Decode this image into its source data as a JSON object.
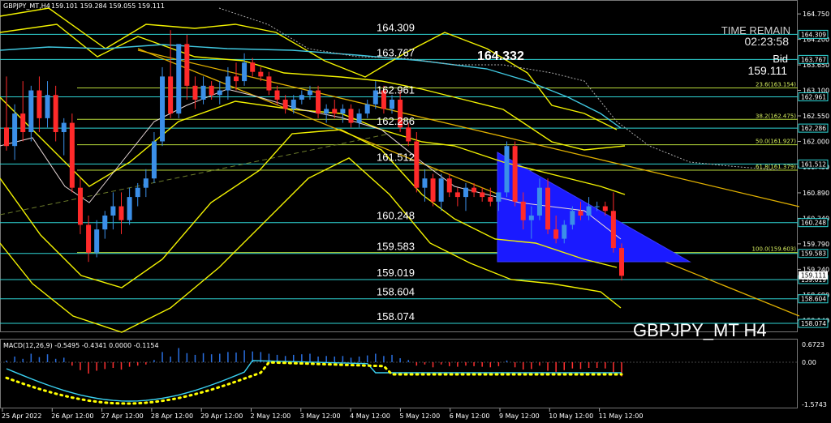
{
  "header": {
    "symbol_line": "GBPJPY_MT,H4",
    "ohlc": "159.101 159.284 159.055 159.111"
  },
  "time_remain": {
    "label": "TIME REMAIN",
    "value": "02:23:58"
  },
  "bid": {
    "label": "Bid",
    "value": "159.111"
  },
  "high_marker": "164.332",
  "watermark": "GBPJPY_MT H4",
  "macd": {
    "label": "MACD(12,26,9) -0.5495 -0.4341 0.0000 -0.1154",
    "axis_ticks": [
      "0.6723",
      "0.00",
      "-1.5743"
    ]
  },
  "price_axis": {
    "ticks": [
      "164.750",
      "164.200",
      "163.650",
      "163.100",
      "162.550",
      "162.000",
      "161.450",
      "160.890",
      "160.340",
      "159.790",
      "159.240",
      "158.690",
      "158.140"
    ],
    "tag_labels": [
      "164.309",
      "163.767",
      "162.961",
      "162.286",
      "161.512",
      "160.248",
      "159.583",
      "159.019",
      "158.604",
      "158.074"
    ],
    "current_price_tag": "159.111"
  },
  "time_axis": {
    "labels": [
      "25 Apr 2022",
      "26 Apr 12:00",
      "27 Apr 12:00",
      "28 Apr 12:00",
      "29 Apr 12:00",
      "2 May 12:00",
      "3 May 12:00",
      "4 May 12:00",
      "5 May 12:00",
      "6 May 12:00",
      "9 May 12:00",
      "10 May 12:00",
      "11 May 12:00"
    ]
  },
  "chart_data": {
    "type": "candlestick",
    "ylim": [
      157.9,
      165.05
    ],
    "horizontal_levels": [
      {
        "label": "164.309",
        "value": 164.309
      },
      {
        "label": "163.767",
        "value": 163.767
      },
      {
        "label": "162.961",
        "value": 162.961
      },
      {
        "label": "162.286",
        "value": 162.286
      },
      {
        "label": "161.512",
        "value": 161.512
      },
      {
        "label": "160.248",
        "value": 160.248
      },
      {
        "label": "159.583",
        "value": 159.583
      },
      {
        "label": "159.019",
        "value": 159.019
      },
      {
        "label": "158.604",
        "value": 158.604
      },
      {
        "label": "158.074",
        "value": 158.074
      }
    ],
    "fibonacci": [
      {
        "label": "23.6(163.154)",
        "value": 163.154
      },
      {
        "label": "38.2(162.475)",
        "value": 162.475
      },
      {
        "label": "50.0(161.927)",
        "value": 161.927
      },
      {
        "label": "61.8(161.379)",
        "value": 161.379
      },
      {
        "label": "100.0(159.603)",
        "value": 159.603
      }
    ],
    "candles": [
      {
        "o": 162.3,
        "h": 163.4,
        "l": 161.8,
        "c": 161.9
      },
      {
        "o": 161.9,
        "h": 162.8,
        "l": 161.6,
        "c": 162.6
      },
      {
        "o": 162.6,
        "h": 163.3,
        "l": 162.0,
        "c": 162.2
      },
      {
        "o": 162.2,
        "h": 163.2,
        "l": 162.0,
        "c": 163.1
      },
      {
        "o": 163.1,
        "h": 163.4,
        "l": 162.2,
        "c": 162.5
      },
      {
        "o": 162.5,
        "h": 163.3,
        "l": 162.3,
        "c": 163.0
      },
      {
        "o": 163.0,
        "h": 163.2,
        "l": 162.0,
        "c": 162.2
      },
      {
        "o": 162.2,
        "h": 162.5,
        "l": 161.7,
        "c": 162.4
      },
      {
        "o": 162.4,
        "h": 162.6,
        "l": 160.9,
        "c": 161.0
      },
      {
        "o": 161.0,
        "h": 161.2,
        "l": 160.0,
        "c": 160.2
      },
      {
        "o": 160.2,
        "h": 160.4,
        "l": 159.4,
        "c": 159.6
      },
      {
        "o": 159.6,
        "h": 160.3,
        "l": 159.5,
        "c": 160.1
      },
      {
        "o": 160.1,
        "h": 160.5,
        "l": 159.9,
        "c": 160.4
      },
      {
        "o": 160.4,
        "h": 160.9,
        "l": 160.1,
        "c": 160.6
      },
      {
        "o": 160.6,
        "h": 160.9,
        "l": 160.0,
        "c": 160.3
      },
      {
        "o": 160.3,
        "h": 161.0,
        "l": 160.2,
        "c": 160.8
      },
      {
        "o": 160.8,
        "h": 161.1,
        "l": 160.6,
        "c": 161.0
      },
      {
        "o": 161.0,
        "h": 161.4,
        "l": 160.8,
        "c": 161.2
      },
      {
        "o": 161.2,
        "h": 162.2,
        "l": 161.1,
        "c": 162.0
      },
      {
        "o": 162.0,
        "h": 163.6,
        "l": 161.9,
        "c": 163.4
      },
      {
        "o": 163.4,
        "h": 164.4,
        "l": 162.5,
        "c": 162.6
      },
      {
        "o": 162.6,
        "h": 163.3,
        "l": 162.5,
        "c": 164.1
      },
      {
        "o": 164.1,
        "h": 164.3,
        "l": 162.9,
        "c": 163.2
      },
      {
        "o": 163.2,
        "h": 163.4,
        "l": 162.7,
        "c": 162.9
      },
      {
        "o": 162.9,
        "h": 163.4,
        "l": 162.8,
        "c": 163.2
      },
      {
        "o": 163.2,
        "h": 163.3,
        "l": 162.9,
        "c": 163.0
      },
      {
        "o": 163.0,
        "h": 163.3,
        "l": 162.8,
        "c": 163.1
      },
      {
        "o": 163.1,
        "h": 163.6,
        "l": 162.9,
        "c": 163.4
      },
      {
        "o": 163.4,
        "h": 163.7,
        "l": 163.1,
        "c": 163.3
      },
      {
        "o": 163.3,
        "h": 163.9,
        "l": 163.2,
        "c": 163.7
      },
      {
        "o": 163.7,
        "h": 163.8,
        "l": 163.4,
        "c": 163.5
      },
      {
        "o": 163.5,
        "h": 163.6,
        "l": 163.3,
        "c": 163.4
      },
      {
        "o": 163.4,
        "h": 163.5,
        "l": 163.0,
        "c": 163.1
      },
      {
        "o": 163.1,
        "h": 163.2,
        "l": 162.8,
        "c": 162.9
      },
      {
        "o": 162.9,
        "h": 163.0,
        "l": 162.6,
        "c": 162.7
      },
      {
        "o": 162.7,
        "h": 163.0,
        "l": 162.6,
        "c": 162.9
      },
      {
        "o": 162.9,
        "h": 163.1,
        "l": 162.8,
        "c": 163.0
      },
      {
        "o": 163.0,
        "h": 163.2,
        "l": 162.9,
        "c": 163.1
      },
      {
        "o": 163.1,
        "h": 163.2,
        "l": 162.5,
        "c": 162.6
      },
      {
        "o": 162.6,
        "h": 162.8,
        "l": 162.4,
        "c": 162.7
      },
      {
        "o": 162.7,
        "h": 162.9,
        "l": 162.5,
        "c": 162.6
      },
      {
        "o": 162.6,
        "h": 162.8,
        "l": 162.4,
        "c": 162.7
      },
      {
        "o": 162.7,
        "h": 162.8,
        "l": 162.3,
        "c": 162.4
      },
      {
        "o": 162.4,
        "h": 162.7,
        "l": 162.3,
        "c": 162.6
      },
      {
        "o": 162.6,
        "h": 162.9,
        "l": 162.5,
        "c": 162.8
      },
      {
        "o": 162.8,
        "h": 163.3,
        "l": 162.7,
        "c": 163.1
      },
      {
        "o": 163.1,
        "h": 163.2,
        "l": 162.6,
        "c": 162.7
      },
      {
        "o": 162.7,
        "h": 163.0,
        "l": 162.6,
        "c": 162.9
      },
      {
        "o": 162.9,
        "h": 163.1,
        "l": 162.2,
        "c": 162.3
      },
      {
        "o": 162.3,
        "h": 162.4,
        "l": 161.9,
        "c": 162.0
      },
      {
        "o": 162.0,
        "h": 162.2,
        "l": 160.9,
        "c": 161.0
      },
      {
        "o": 161.0,
        "h": 161.4,
        "l": 160.7,
        "c": 161.2
      },
      {
        "o": 161.2,
        "h": 161.3,
        "l": 160.6,
        "c": 160.7
      },
      {
        "o": 160.7,
        "h": 161.3,
        "l": 160.5,
        "c": 161.2
      },
      {
        "o": 161.2,
        "h": 161.3,
        "l": 160.8,
        "c": 160.9
      },
      {
        "o": 160.9,
        "h": 161.0,
        "l": 160.6,
        "c": 160.8
      },
      {
        "o": 160.8,
        "h": 161.1,
        "l": 160.5,
        "c": 161.0
      },
      {
        "o": 161.0,
        "h": 161.1,
        "l": 160.8,
        "c": 160.9
      },
      {
        "o": 160.9,
        "h": 161.0,
        "l": 160.7,
        "c": 160.8
      },
      {
        "o": 160.8,
        "h": 161.0,
        "l": 160.6,
        "c": 160.7
      },
      {
        "o": 160.7,
        "h": 160.9,
        "l": 160.5,
        "c": 160.9
      },
      {
        "o": 160.9,
        "h": 162.0,
        "l": 160.8,
        "c": 161.9
      },
      {
        "o": 161.9,
        "h": 162.0,
        "l": 160.6,
        "c": 160.7
      },
      {
        "o": 160.7,
        "h": 160.9,
        "l": 160.1,
        "c": 160.3
      },
      {
        "o": 160.3,
        "h": 160.6,
        "l": 159.9,
        "c": 160.4
      },
      {
        "o": 160.4,
        "h": 161.2,
        "l": 160.3,
        "c": 161.0
      },
      {
        "o": 161.0,
        "h": 161.2,
        "l": 160.0,
        "c": 160.1
      },
      {
        "o": 160.1,
        "h": 160.4,
        "l": 159.8,
        "c": 159.9
      },
      {
        "o": 159.9,
        "h": 160.3,
        "l": 159.8,
        "c": 160.2
      },
      {
        "o": 160.2,
        "h": 160.6,
        "l": 160.1,
        "c": 160.5
      },
      {
        "o": 160.5,
        "h": 160.7,
        "l": 160.3,
        "c": 160.4
      },
      {
        "o": 160.4,
        "h": 160.8,
        "l": 160.3,
        "c": 160.6
      },
      {
        "o": 160.6,
        "h": 160.7,
        "l": 160.5,
        "c": 160.6
      },
      {
        "o": 160.6,
        "h": 160.7,
        "l": 160.4,
        "c": 160.5
      },
      {
        "o": 160.5,
        "h": 160.9,
        "l": 159.6,
        "c": 159.7
      },
      {
        "o": 159.7,
        "h": 159.8,
        "l": 159.0,
        "c": 159.1
      }
    ]
  }
}
